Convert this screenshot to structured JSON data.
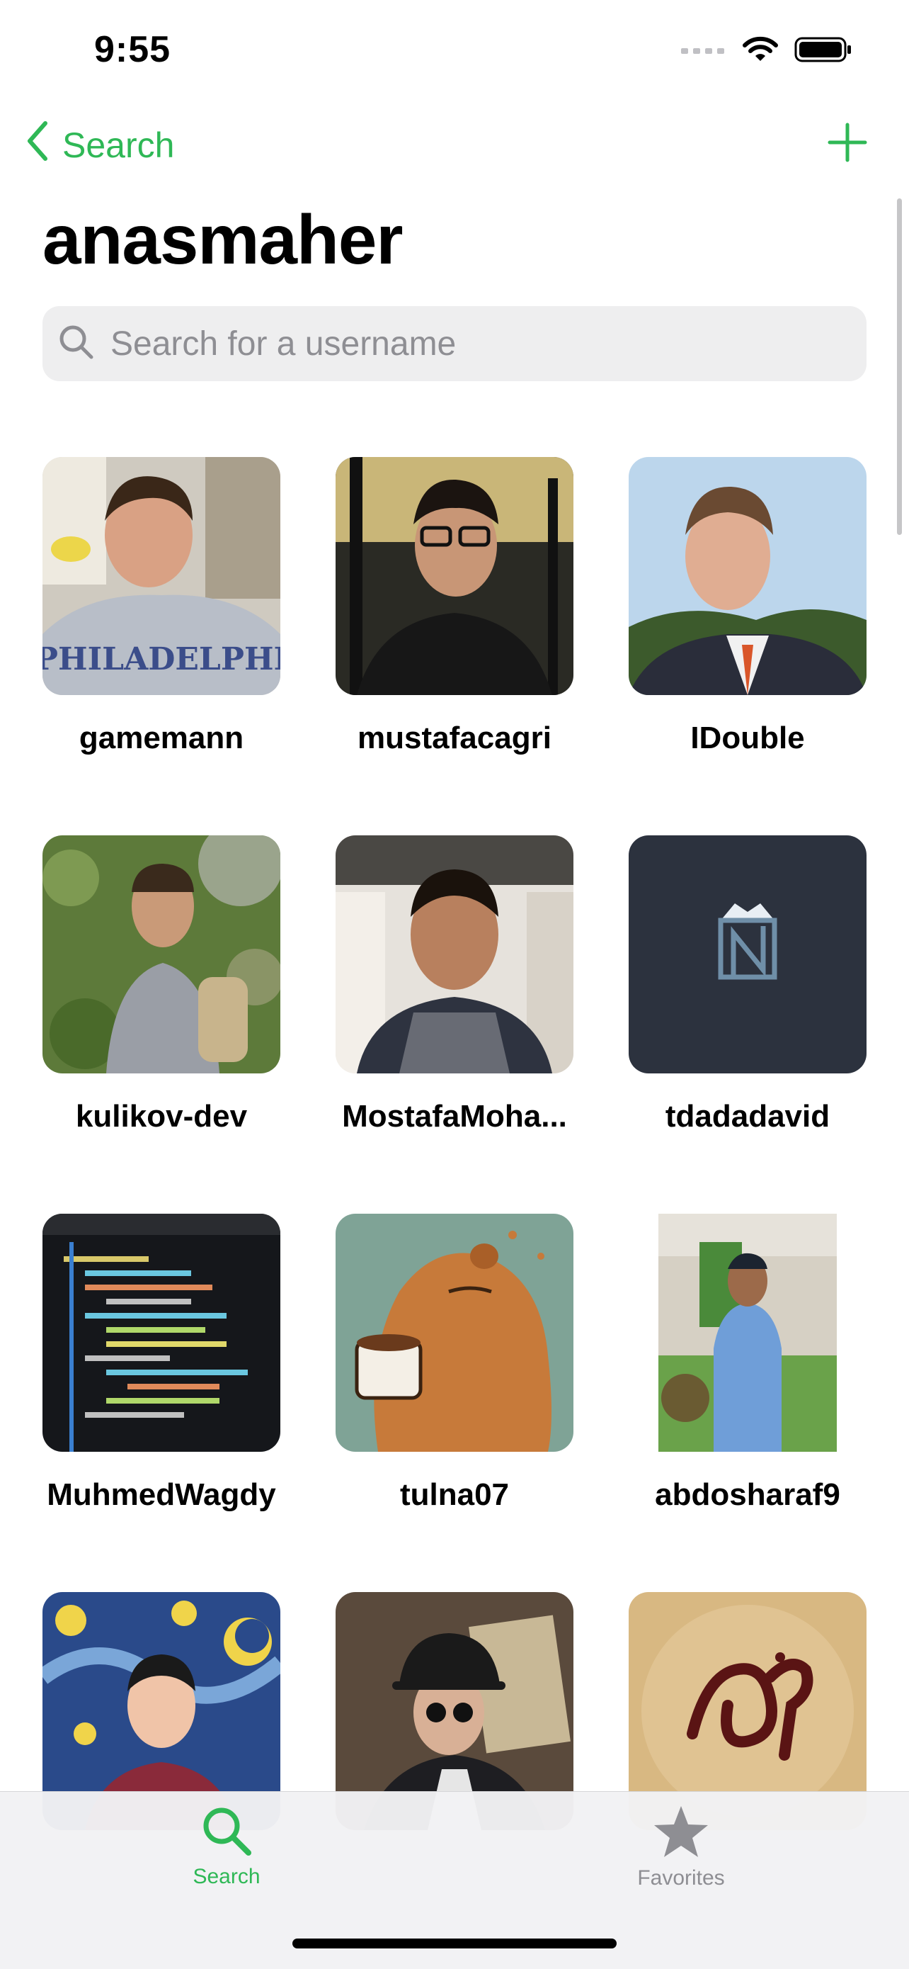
{
  "status": {
    "time": "9:55"
  },
  "nav": {
    "back_label": "Search"
  },
  "title": "anasmaher",
  "search": {
    "placeholder": "Search for a username",
    "value": ""
  },
  "users": [
    {
      "name": "gamemann"
    },
    {
      "name": "mustafacagri"
    },
    {
      "name": "IDouble"
    },
    {
      "name": "kulikov-dev"
    },
    {
      "name": "MostafaMoha..."
    },
    {
      "name": "tdadadavid"
    },
    {
      "name": "MuhmedWagdy"
    },
    {
      "name": "tulna07"
    },
    {
      "name": "abdosharaf9"
    }
  ],
  "tabs": [
    {
      "label": "Search",
      "icon": "search-icon",
      "active": true
    },
    {
      "label": "Favorites",
      "icon": "star-icon",
      "active": false
    }
  ],
  "colors": {
    "accent": "#2fb856",
    "inactive": "#8e8e93",
    "background": "#ffffff"
  }
}
